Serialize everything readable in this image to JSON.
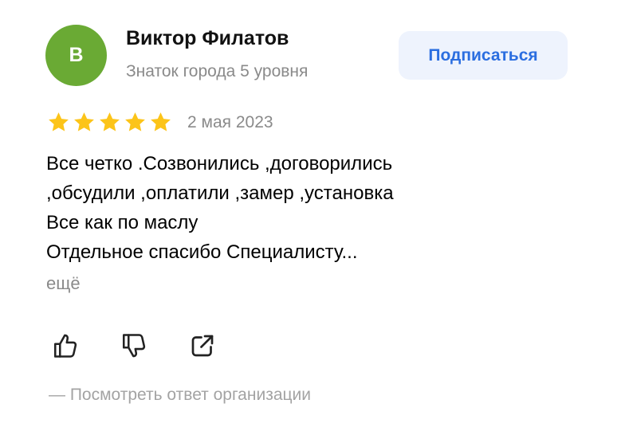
{
  "author": {
    "avatar_letter": "В",
    "avatar_color": "#6aaa34",
    "name": "Виктор Филатов",
    "level": "Знаток города 5 уровня"
  },
  "subscribe_label": "Подписаться",
  "review": {
    "rating": 5,
    "rating_max": 5,
    "star_color": "#fcc419",
    "date": "2 мая 2023",
    "lines": [
      "Все четко .Созвонились ,договорились",
      ",обсудили ,оплатили ,замер ,установка",
      "Все как по маслу",
      "Отдельное спасибо Специалисту..."
    ],
    "more_label": "ещё"
  },
  "actions": {
    "like_icon": "thumbs-up-icon",
    "dislike_icon": "thumbs-down-icon",
    "share_icon": "share-external-icon"
  },
  "org_reply_label": "—  Посмотреть ответ организации",
  "colors": {
    "accent": "#2b6ee0",
    "subscribe_bg": "#eef3fd",
    "muted_text": "#8a8a8a"
  }
}
